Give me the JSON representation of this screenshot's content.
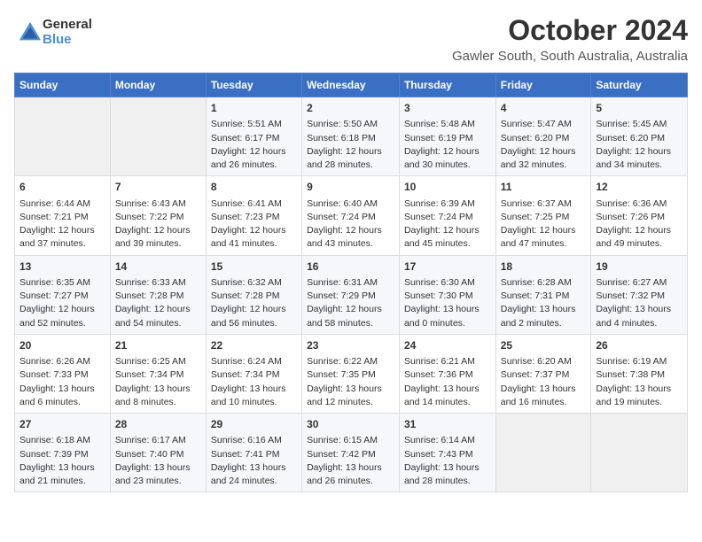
{
  "logo": {
    "general": "General",
    "blue": "Blue"
  },
  "title": "October 2024",
  "location": "Gawler South, South Australia, Australia",
  "days_of_week": [
    "Sunday",
    "Monday",
    "Tuesday",
    "Wednesday",
    "Thursday",
    "Friday",
    "Saturday"
  ],
  "weeks": [
    [
      {
        "day": "",
        "sunrise": "",
        "sunset": "",
        "daylight": ""
      },
      {
        "day": "",
        "sunrise": "",
        "sunset": "",
        "daylight": ""
      },
      {
        "day": "1",
        "sunrise": "Sunrise: 5:51 AM",
        "sunset": "Sunset: 6:17 PM",
        "daylight": "Daylight: 12 hours and 26 minutes."
      },
      {
        "day": "2",
        "sunrise": "Sunrise: 5:50 AM",
        "sunset": "Sunset: 6:18 PM",
        "daylight": "Daylight: 12 hours and 28 minutes."
      },
      {
        "day": "3",
        "sunrise": "Sunrise: 5:48 AM",
        "sunset": "Sunset: 6:19 PM",
        "daylight": "Daylight: 12 hours and 30 minutes."
      },
      {
        "day": "4",
        "sunrise": "Sunrise: 5:47 AM",
        "sunset": "Sunset: 6:20 PM",
        "daylight": "Daylight: 12 hours and 32 minutes."
      },
      {
        "day": "5",
        "sunrise": "Sunrise: 5:45 AM",
        "sunset": "Sunset: 6:20 PM",
        "daylight": "Daylight: 12 hours and 34 minutes."
      }
    ],
    [
      {
        "day": "6",
        "sunrise": "Sunrise: 6:44 AM",
        "sunset": "Sunset: 7:21 PM",
        "daylight": "Daylight: 12 hours and 37 minutes."
      },
      {
        "day": "7",
        "sunrise": "Sunrise: 6:43 AM",
        "sunset": "Sunset: 7:22 PM",
        "daylight": "Daylight: 12 hours and 39 minutes."
      },
      {
        "day": "8",
        "sunrise": "Sunrise: 6:41 AM",
        "sunset": "Sunset: 7:23 PM",
        "daylight": "Daylight: 12 hours and 41 minutes."
      },
      {
        "day": "9",
        "sunrise": "Sunrise: 6:40 AM",
        "sunset": "Sunset: 7:24 PM",
        "daylight": "Daylight: 12 hours and 43 minutes."
      },
      {
        "day": "10",
        "sunrise": "Sunrise: 6:39 AM",
        "sunset": "Sunset: 7:24 PM",
        "daylight": "Daylight: 12 hours and 45 minutes."
      },
      {
        "day": "11",
        "sunrise": "Sunrise: 6:37 AM",
        "sunset": "Sunset: 7:25 PM",
        "daylight": "Daylight: 12 hours and 47 minutes."
      },
      {
        "day": "12",
        "sunrise": "Sunrise: 6:36 AM",
        "sunset": "Sunset: 7:26 PM",
        "daylight": "Daylight: 12 hours and 49 minutes."
      }
    ],
    [
      {
        "day": "13",
        "sunrise": "Sunrise: 6:35 AM",
        "sunset": "Sunset: 7:27 PM",
        "daylight": "Daylight: 12 hours and 52 minutes."
      },
      {
        "day": "14",
        "sunrise": "Sunrise: 6:33 AM",
        "sunset": "Sunset: 7:28 PM",
        "daylight": "Daylight: 12 hours and 54 minutes."
      },
      {
        "day": "15",
        "sunrise": "Sunrise: 6:32 AM",
        "sunset": "Sunset: 7:28 PM",
        "daylight": "Daylight: 12 hours and 56 minutes."
      },
      {
        "day": "16",
        "sunrise": "Sunrise: 6:31 AM",
        "sunset": "Sunset: 7:29 PM",
        "daylight": "Daylight: 12 hours and 58 minutes."
      },
      {
        "day": "17",
        "sunrise": "Sunrise: 6:30 AM",
        "sunset": "Sunset: 7:30 PM",
        "daylight": "Daylight: 13 hours and 0 minutes."
      },
      {
        "day": "18",
        "sunrise": "Sunrise: 6:28 AM",
        "sunset": "Sunset: 7:31 PM",
        "daylight": "Daylight: 13 hours and 2 minutes."
      },
      {
        "day": "19",
        "sunrise": "Sunrise: 6:27 AM",
        "sunset": "Sunset: 7:32 PM",
        "daylight": "Daylight: 13 hours and 4 minutes."
      }
    ],
    [
      {
        "day": "20",
        "sunrise": "Sunrise: 6:26 AM",
        "sunset": "Sunset: 7:33 PM",
        "daylight": "Daylight: 13 hours and 6 minutes."
      },
      {
        "day": "21",
        "sunrise": "Sunrise: 6:25 AM",
        "sunset": "Sunset: 7:34 PM",
        "daylight": "Daylight: 13 hours and 8 minutes."
      },
      {
        "day": "22",
        "sunrise": "Sunrise: 6:24 AM",
        "sunset": "Sunset: 7:34 PM",
        "daylight": "Daylight: 13 hours and 10 minutes."
      },
      {
        "day": "23",
        "sunrise": "Sunrise: 6:22 AM",
        "sunset": "Sunset: 7:35 PM",
        "daylight": "Daylight: 13 hours and 12 minutes."
      },
      {
        "day": "24",
        "sunrise": "Sunrise: 6:21 AM",
        "sunset": "Sunset: 7:36 PM",
        "daylight": "Daylight: 13 hours and 14 minutes."
      },
      {
        "day": "25",
        "sunrise": "Sunrise: 6:20 AM",
        "sunset": "Sunset: 7:37 PM",
        "daylight": "Daylight: 13 hours and 16 minutes."
      },
      {
        "day": "26",
        "sunrise": "Sunrise: 6:19 AM",
        "sunset": "Sunset: 7:38 PM",
        "daylight": "Daylight: 13 hours and 19 minutes."
      }
    ],
    [
      {
        "day": "27",
        "sunrise": "Sunrise: 6:18 AM",
        "sunset": "Sunset: 7:39 PM",
        "daylight": "Daylight: 13 hours and 21 minutes."
      },
      {
        "day": "28",
        "sunrise": "Sunrise: 6:17 AM",
        "sunset": "Sunset: 7:40 PM",
        "daylight": "Daylight: 13 hours and 23 minutes."
      },
      {
        "day": "29",
        "sunrise": "Sunrise: 6:16 AM",
        "sunset": "Sunset: 7:41 PM",
        "daylight": "Daylight: 13 hours and 24 minutes."
      },
      {
        "day": "30",
        "sunrise": "Sunrise: 6:15 AM",
        "sunset": "Sunset: 7:42 PM",
        "daylight": "Daylight: 13 hours and 26 minutes."
      },
      {
        "day": "31",
        "sunrise": "Sunrise: 6:14 AM",
        "sunset": "Sunset: 7:43 PM",
        "daylight": "Daylight: 13 hours and 28 minutes."
      },
      {
        "day": "",
        "sunrise": "",
        "sunset": "",
        "daylight": ""
      },
      {
        "day": "",
        "sunrise": "",
        "sunset": "",
        "daylight": ""
      }
    ]
  ]
}
